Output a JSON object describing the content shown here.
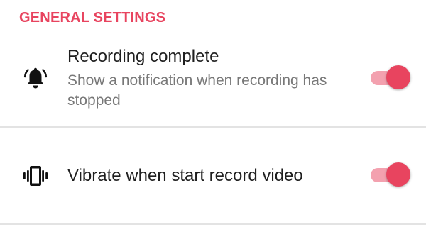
{
  "colors": {
    "accent": "#e8445f",
    "title_text": "#1f1f1f",
    "summary_text": "#787878",
    "divider": "#e3e3e3"
  },
  "section": {
    "header": "GENERAL SETTINGS"
  },
  "settings": [
    {
      "icon": "bell-ringing-icon",
      "title": "Recording complete",
      "summary": "Show a notification when recording has stopped",
      "enabled": true
    },
    {
      "icon": "vibrate-icon",
      "title": "Vibrate when start record video",
      "summary": "",
      "enabled": true
    }
  ]
}
